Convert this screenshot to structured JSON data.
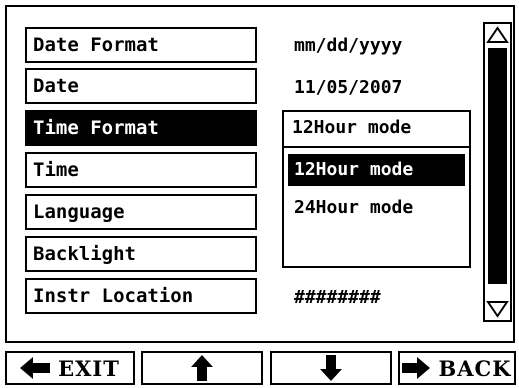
{
  "settings": {
    "rows": [
      {
        "label": "Date Format",
        "value": "mm/dd/yyyy"
      },
      {
        "label": "Date",
        "value": "11/05/2007"
      },
      {
        "label": "Time Format",
        "value": ""
      },
      {
        "label": "Time",
        "value": ""
      },
      {
        "label": "Language",
        "value": ""
      },
      {
        "label": "Backlight",
        "value": ""
      },
      {
        "label": "Instr Location",
        "value": "########"
      }
    ],
    "selected_row": "Time Format"
  },
  "dropdown": {
    "current": "12Hour mode",
    "options": [
      "12Hour mode",
      "24Hour mode"
    ],
    "highlighted": "12Hour mode"
  },
  "buttons": {
    "exit": "EXIT",
    "up_icon": "arrow-up-icon",
    "down_icon": "arrow-down-icon",
    "back": "BACK"
  }
}
